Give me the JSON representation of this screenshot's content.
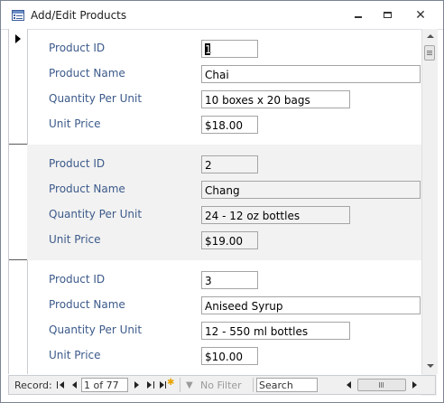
{
  "window": {
    "title": "Add/Edit Products",
    "title_icon": "form-icon",
    "minimize_icon": "minimize-icon",
    "restore_icon": "restore-icon",
    "close_icon": "close-icon",
    "close_glyph": "✕"
  },
  "labels": {
    "product_id": "Product ID",
    "product_name": "Product Name",
    "quantity_per_unit": "Quantity Per Unit",
    "unit_price": "Unit Price"
  },
  "records": [
    {
      "product_id": "1",
      "product_name": "Chai",
      "quantity_per_unit": "10 boxes x 20 bags",
      "unit_price": "$18.00",
      "current": true
    },
    {
      "product_id": "2",
      "product_name": "Chang",
      "quantity_per_unit": "24 - 12 oz bottles",
      "unit_price": "$19.00",
      "current": false
    },
    {
      "product_id": "3",
      "product_name": "Aniseed Syrup",
      "quantity_per_unit": "12 - 550 ml bottles",
      "unit_price": "$10.00",
      "current": false
    }
  ],
  "navigation": {
    "record_label": "Record:",
    "record_position": "1 of 77",
    "filter_label": "No Filter",
    "search_placeholder": "Search",
    "icons": [
      "first-record-icon",
      "previous-record-icon",
      "next-record-icon",
      "last-record-icon",
      "new-record-icon",
      "filter-icon"
    ]
  },
  "colors": {
    "label_text": "#3c5a8a",
    "alt_row_background": "#f2f2f2",
    "new_record_star": "#e8a400"
  }
}
